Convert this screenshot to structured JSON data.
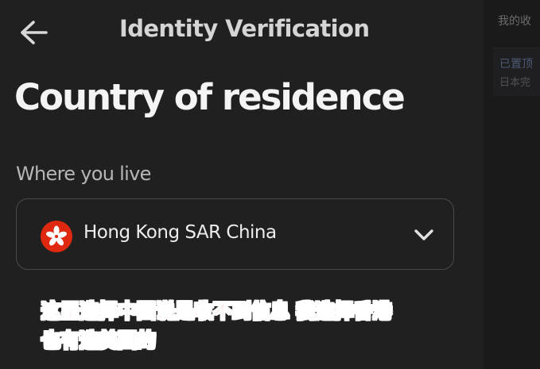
{
  "header": {
    "title": "Identity Verification",
    "back_icon": "arrow-left-icon"
  },
  "page": {
    "title": "Country of residence"
  },
  "residence_field": {
    "label": "Where you live",
    "selected_value": "Hong Kong SAR China",
    "flag_icon": "hong-kong-flag-icon",
    "dropdown_icon": "chevron-down-icon"
  },
  "side_panel": {
    "title": "我的收",
    "line1": "已置顶",
    "line2": "日本完"
  },
  "annotation": {
    "line1": "这里选择中国说是收不到信息 我选择香港",
    "line2": "也有选美国的"
  },
  "colors": {
    "background": "#202021",
    "annotation_text": "#ff2215",
    "flag_red": "#de2910"
  }
}
